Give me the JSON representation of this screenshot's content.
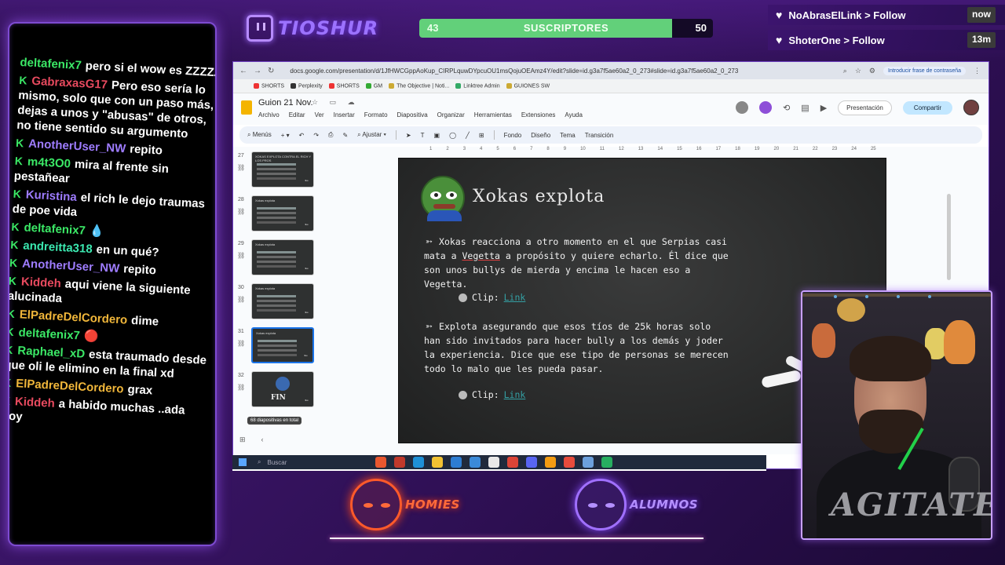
{
  "brand": {
    "name": "TIOSHUR"
  },
  "subscribers": {
    "current": "43",
    "label": "SUSCRIPTORES",
    "goal": "50",
    "progress_fraction": 0.86
  },
  "follows": [
    {
      "text": "NoAbrasElLink > Follow",
      "time": "now"
    },
    {
      "text": "ShoterOne > Follow",
      "time": "13m"
    }
  ],
  "chat": [
    {
      "user": "deltafenix7",
      "color": "#3be866",
      "text": "pero si el wow es ZZZZZ",
      "badge": ""
    },
    {
      "user": "GabraxasG17",
      "color": "#e84a5f",
      "text": "Pero eso sería lo mismo, solo que con un paso más, dejas a unos y \"abusas\" de otros, no tiene sentido su argumento",
      "badge": "K"
    },
    {
      "user": "AnotherUser_NW",
      "color": "#9e7cff",
      "text": "repito",
      "badge": "K"
    },
    {
      "user": "m4t3O0",
      "color": "#3be866",
      "text": "mira al frente sin pestañear",
      "badge": "K"
    },
    {
      "user": "Kuristina",
      "color": "#9e7cff",
      "text": "el rich le dejo traumas de poe vida",
      "badge": "K"
    },
    {
      "user": "deltafenix7",
      "color": "#3be866",
      "text": "💧",
      "badge": "K"
    },
    {
      "user": "andreitta318",
      "color": "#3be8b0",
      "text": "en un qué?",
      "badge": "K"
    },
    {
      "user": "AnotherUser_NW",
      "color": "#9e7cff",
      "text": "repito",
      "badge": "K"
    },
    {
      "user": "Kiddeh",
      "color": "#e84a5f",
      "text": "aqui viene la siguiente alucinada",
      "badge": "K"
    },
    {
      "user": "ElPadreDelCordero",
      "color": "#f0b63a",
      "text": "dime",
      "badge": "K"
    },
    {
      "user": "deltafenix7",
      "color": "#3be866",
      "text": "🔴",
      "badge": "K"
    },
    {
      "user": "Raphael_xD",
      "color": "#3be866",
      "text": "esta traumado desde que oli le elimino en la final xd",
      "badge": "K"
    },
    {
      "user": "ElPadreDelCordero",
      "color": "#f0b63a",
      "text": "grax",
      "badge": "K"
    },
    {
      "user": "Kiddeh",
      "color": "#e84a5f",
      "text": "a habido muchas ..ada hoy",
      "badge": "K"
    }
  ],
  "browser": {
    "url": "docs.google.com/presentation/d/1JfHWCGppAoKup_CIRPLquwDYpcuOU1msQojuOEAmz4Y/edit?slide=id.g3a7f5ae60a2_0_273#slide=id.g3a7f5ae60a2_0_273",
    "password_chip": "Introducir frase de contraseña",
    "bookmarks": [
      "SHORTS",
      "Perplexity",
      "SHORTS",
      "GM",
      "The Objective | Noti...",
      "Linktree Admin",
      "GUIONES SW"
    ]
  },
  "docs": {
    "title": "Guion 21 Nov.",
    "menu": [
      "Archivo",
      "Editar",
      "Ver",
      "Insertar",
      "Formato",
      "Diapositiva",
      "Organizar",
      "Herramientas",
      "Extensiones",
      "Ayuda"
    ],
    "present_label": "Presentación",
    "share_label": "Compartir",
    "toolbar": {
      "menus": "Menús",
      "fit": "Ajustar",
      "background": "Fondo",
      "layout": "Diseño",
      "theme": "Tema",
      "transition": "Transición"
    },
    "ruler_ticks": [
      "1",
      "2",
      "3",
      "4",
      "5",
      "6",
      "7",
      "8",
      "9",
      "10",
      "11",
      "12",
      "13",
      "14",
      "15",
      "16",
      "17",
      "18",
      "19",
      "20",
      "21",
      "22",
      "23",
      "24",
      "25"
    ],
    "slide_count": "68 diapositivas en total",
    "thumbs": [
      {
        "num": "27",
        "title": "XOKAS EXPLOTA CONTRA EL RICH Y LOS PROS"
      },
      {
        "num": "28",
        "title": "Xokas explota"
      },
      {
        "num": "29",
        "title": "Xokas explota"
      },
      {
        "num": "30",
        "title": "Xokas explota"
      },
      {
        "num": "31",
        "title": "Xokas explota"
      },
      {
        "num": "32",
        "title": "FIN"
      }
    ]
  },
  "slide": {
    "title": "Xokas explota",
    "par1_a": "Xokas reacciona a otro momento en el que Serpias casi mata a ",
    "par1_u": "Vegetta",
    "par1_b": " a propósito y quiere echarlo. Él dice que son unos bullys de mierda y encima le hacen eso a Vegetta.",
    "par2": "Explota asegurando que esos tíos de 25k horas solo han sido invitados para hacer bully a los demás y joder la experiencia. Dice que ese tipo de personas se merecen todo lo malo que les pueda pasar.",
    "clip_label": "Clip:",
    "clip_link": "Link"
  },
  "taskbar": {
    "search": "Buscar"
  },
  "webcam": {
    "shirt_text": "AGITATED"
  },
  "bottom": {
    "homies": "HOMIES",
    "alumnos": "ALUMNOS"
  },
  "colors": {
    "accent": "#7d4bd1",
    "subs_fill": "#62d07a",
    "link": "#34a0a4"
  }
}
